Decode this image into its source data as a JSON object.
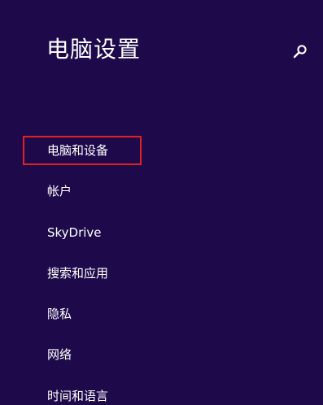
{
  "header": {
    "title": "电脑设置",
    "search_icon": "search-icon"
  },
  "sidebar": {
    "selected_index": 0,
    "highlight_color": "#e0211f",
    "items": [
      {
        "label": "电脑和设备"
      },
      {
        "label": "帐户"
      },
      {
        "label": "SkyDrive"
      },
      {
        "label": "搜索和应用"
      },
      {
        "label": "隐私"
      },
      {
        "label": "网络"
      },
      {
        "label": "时间和语言"
      }
    ]
  },
  "colors": {
    "background": "#1e0a4b",
    "text": "#ffffff"
  }
}
